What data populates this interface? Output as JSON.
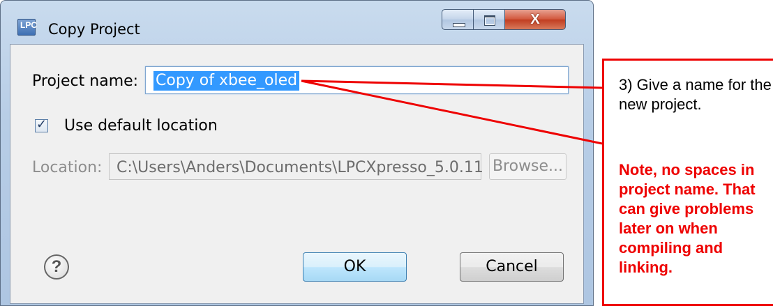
{
  "window": {
    "title": "Copy Project",
    "app_icon_text": "LPC",
    "controls": {
      "minimize": "minimize",
      "maximize": "maximize",
      "close": "X"
    }
  },
  "form": {
    "project_name_label": "Project name:",
    "project_name_value": "Copy of xbee_oled",
    "use_default_location_label": "Use default location",
    "use_default_location_checked": true,
    "checkbox_mark": "✓",
    "location_label": "Location:",
    "location_value": "C:\\Users\\Anders\\Documents\\LPCXpresso_5.0.11",
    "browse_label": "Browse..."
  },
  "buttons": {
    "help": "?",
    "ok": "OK",
    "cancel": "Cancel"
  },
  "annotation": {
    "step_text": "3) Give a name for the new project.",
    "warning_text": "Note, no spaces in project name. That can give problems later on when compiling and linking.",
    "color": "#ee0000"
  },
  "colors": {
    "selection": "#3399ff",
    "dialog_bg": "#f0f0f0"
  }
}
